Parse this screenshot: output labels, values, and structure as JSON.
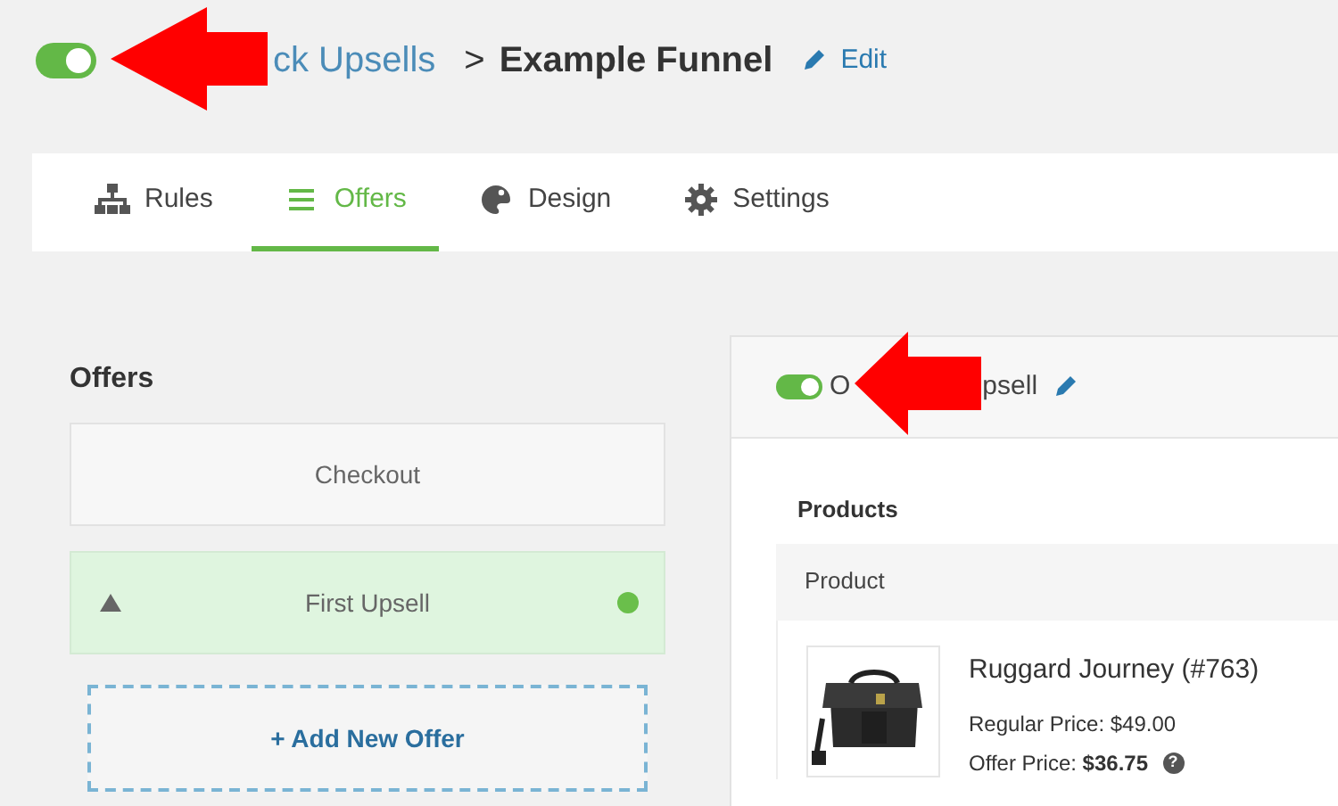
{
  "header": {
    "toggle": {
      "on": true
    },
    "breadcrumb": {
      "parent": "ck Upsells",
      "separator": ">",
      "current": "Example Funnel"
    },
    "edit": "Edit"
  },
  "tabs": [
    {
      "text": "Rules",
      "selected": false
    },
    {
      "text": "Offers",
      "selected": true
    },
    {
      "text": "Design",
      "selected": false
    },
    {
      "text": "Settings",
      "selected": false
    }
  ],
  "offers": {
    "title": "Offers",
    "items": [
      {
        "label": "Checkout",
        "selected": false,
        "kind": "checkout"
      },
      {
        "label": "First Upsell",
        "selected": true,
        "kind": "upsell",
        "color": "#6abf4b"
      }
    ],
    "add": "+ Add New Offer"
  },
  "panel": {
    "toggle": {
      "on": true
    },
    "title_parts": [
      "O",
      "psell"
    ],
    "products_label": "Products",
    "column": "Product",
    "product": {
      "name": "Ruggard Journey (#763)",
      "regular": "Regular Price: $49.00",
      "offer": "Offer Price: **$36.75**",
      "help": "?"
    }
  },
  "annotations": [
    {
      "kind": "arrow"
    },
    {
      "kind": "arrow"
    }
  ]
}
